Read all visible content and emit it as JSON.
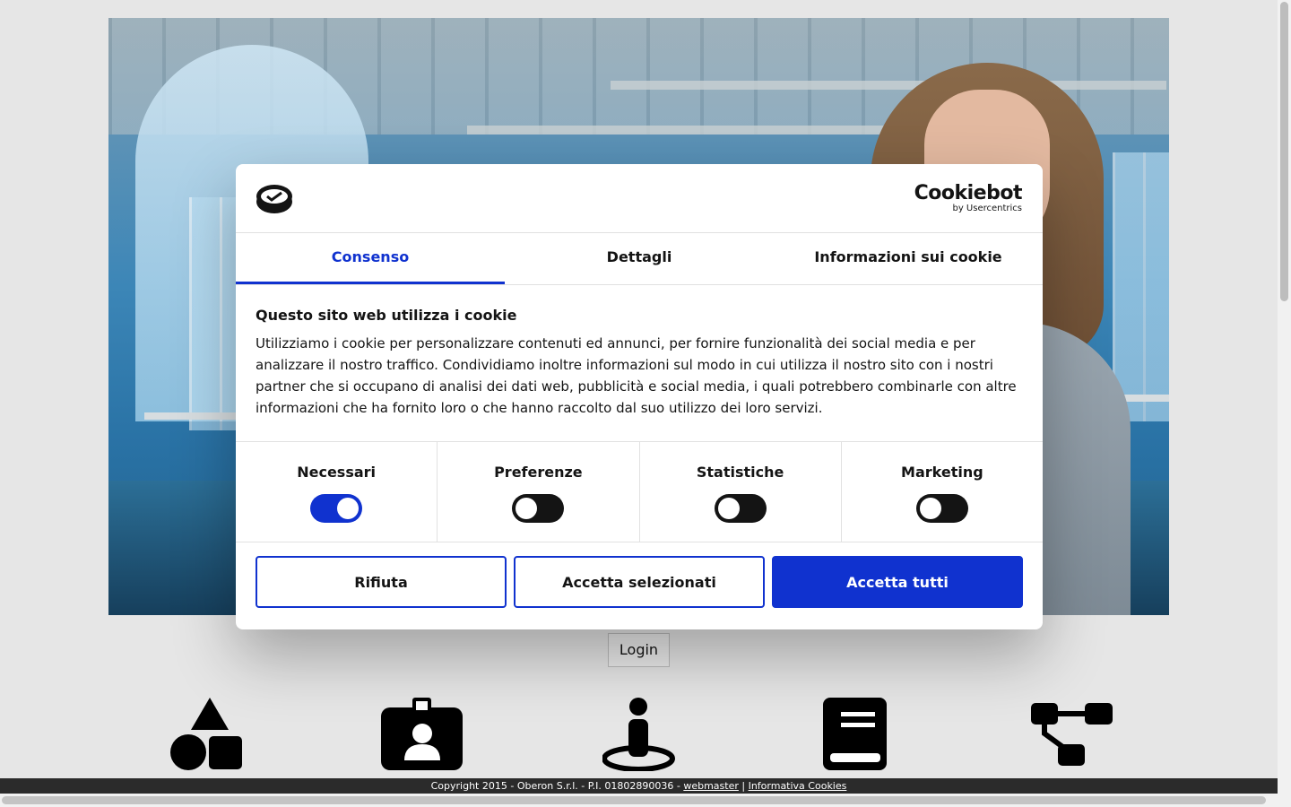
{
  "dialog": {
    "brand_name": "Cookiebot",
    "brand_sub": "by Usercentrics",
    "tabs": [
      {
        "label": "Consenso",
        "active": true
      },
      {
        "label": "Dettagli",
        "active": false
      },
      {
        "label": "Informazioni sui cookie",
        "active": false
      }
    ],
    "heading": "Questo sito web utilizza i cookie",
    "text": "Utilizziamo i cookie per personalizzare contenuti ed annunci, per fornire funzionalità dei social media e per analizzare il nostro traffico. Condividiamo inoltre informazioni sul modo in cui utilizza il nostro sito con i nostri partner che si occupano di analisi dei dati web, pubblicità e social media, i quali potrebbero combinarle con altre informazioni che ha fornito loro o che hanno raccolto dal suo utilizzo dei loro servizi.",
    "toggles": [
      {
        "label": "Necessari",
        "on": true
      },
      {
        "label": "Preferenze",
        "on": false
      },
      {
        "label": "Statistiche",
        "on": false
      },
      {
        "label": "Marketing",
        "on": false
      }
    ],
    "buttons": {
      "reject": "Rifiuta",
      "accept_selected": "Accetta selezionati",
      "accept_all": "Accetta tutti"
    },
    "accent_color": "#1032cf"
  },
  "login_label": "Login",
  "icons": [
    "shapes-icon",
    "id-badge-icon",
    "person-location-icon",
    "book-icon",
    "sitemap-icon"
  ],
  "footer": {
    "text": "Copyright 2015 - Oberon S.r.l. - P.I. 01802890036 - ",
    "webmaster": "webmaster",
    "separator": " | ",
    "cookie_policy": "Informativa Cookies"
  }
}
